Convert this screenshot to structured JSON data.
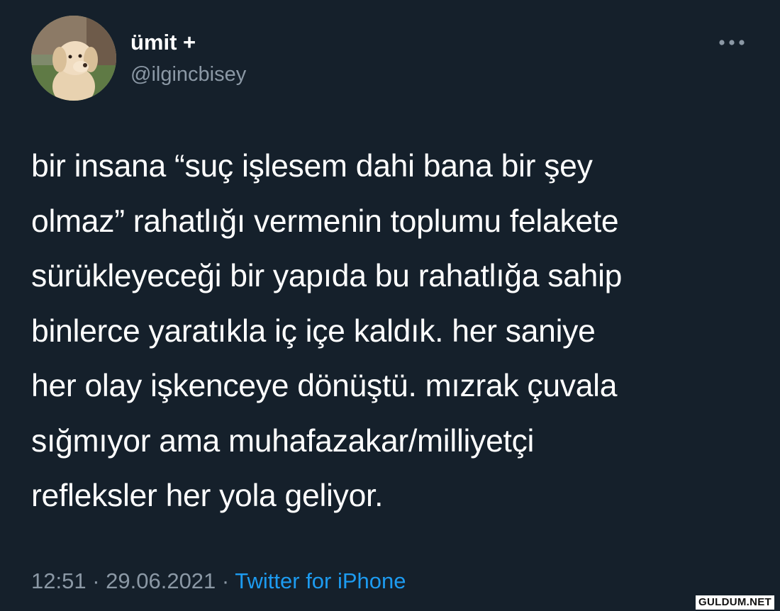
{
  "user": {
    "display_name": "ümit +",
    "handle": "@ilgincbisey",
    "avatar_icon": "dog-avatar"
  },
  "menu": {
    "icon": "more-horizontal-icon"
  },
  "tweet": {
    "text": "bir insana “suç işlesem dahi bana bir şey\nolmaz” rahatlığı vermenin toplumu felakete\nsürükleyeceği bir yapıda bu rahatlığa sahip\nbinlerce yaratıkla iç içe kaldık. her saniye\nher olay işkenceye dönüştü. mızrak çuvala\nsığmıyor ama muhafazakar/milliyetçi\nrefleksler her yola geliyor.",
    "time": "12:51",
    "separator": " · ",
    "date": "29.06.2021",
    "source": "Twitter for iPhone"
  },
  "watermark": {
    "text": "GULDUM.NET"
  },
  "colors": {
    "background": "#15202b",
    "primary_text": "#ffffff",
    "secondary_text": "#8b98a5",
    "link": "#1d9bf0"
  }
}
